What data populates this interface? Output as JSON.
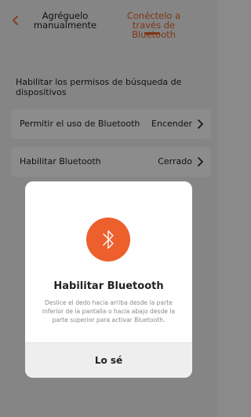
{
  "header": {
    "tab_manual": "Agréguelo manualmente",
    "tab_bluetooth": "Conéctelo a través de Bluetooth",
    "accent_color": "#e8632a"
  },
  "main": {
    "heading": "Habilitar los permisos de búsqueda de dispositivos",
    "rows": [
      {
        "label": "Permitir el uso de Bluetooth",
        "value": "Encender"
      },
      {
        "label": "Habilitar Bluetooth",
        "value": "Cerrado"
      }
    ]
  },
  "dialog": {
    "icon": "bluetooth-icon",
    "title": "Habilitar Bluetooth",
    "body": "Deslice el dedo hacia arriba desde la parte inferior de la pantalla o hacia abajo desde la parte superior para activar Bluetooth.",
    "button": "Lo sé"
  }
}
